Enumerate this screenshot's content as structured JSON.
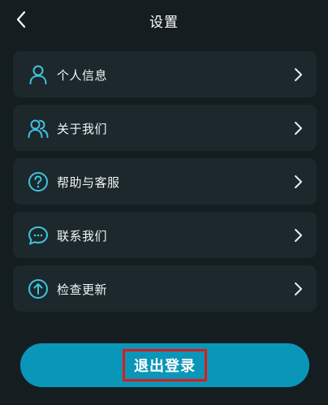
{
  "colors": {
    "background": "#141e21",
    "card": "#1c282c",
    "accent": "#0a96b8",
    "icon": "#3fc3de",
    "highlight_border": "#e01919"
  },
  "header": {
    "title": "设置",
    "back_icon": "chevron-left-icon"
  },
  "menu": {
    "items": [
      {
        "label": "个人信息",
        "icon": "user-icon"
      },
      {
        "label": "关于我们",
        "icon": "users-icon"
      },
      {
        "label": "帮助与客服",
        "icon": "help-circle-icon"
      },
      {
        "label": "联系我们",
        "icon": "chat-bubble-icon"
      },
      {
        "label": "检查更新",
        "icon": "arrow-up-circle-icon"
      }
    ]
  },
  "logout": {
    "label": "退出登录"
  }
}
